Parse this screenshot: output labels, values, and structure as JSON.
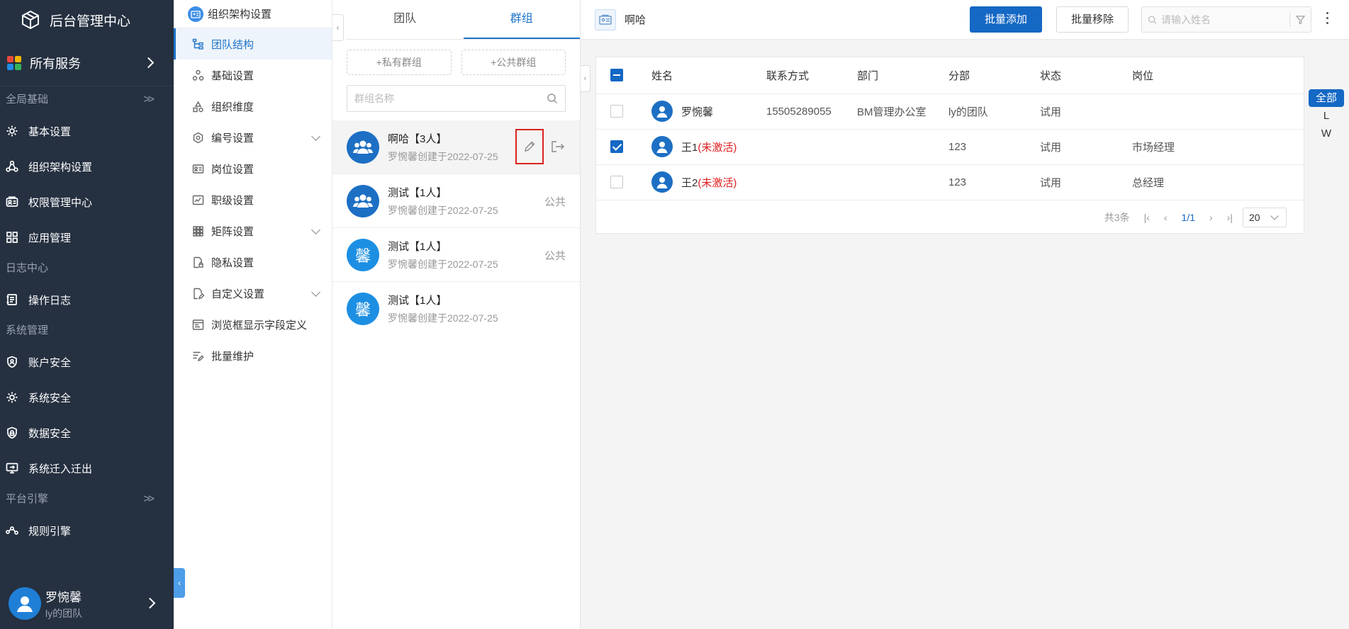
{
  "app": {
    "title": "后台管理中心"
  },
  "sidebar": {
    "all_services": "所有服务",
    "groups": [
      {
        "label": "全局基础",
        "items": [
          "基本设置",
          "组织架构设置",
          "权限管理中心",
          "应用管理"
        ]
      },
      {
        "label": "日志中心",
        "items": [
          "操作日志"
        ]
      },
      {
        "label": "系统管理",
        "items": [
          "账户安全",
          "系统安全",
          "数据安全",
          "系统迁入迁出"
        ]
      },
      {
        "label": "平台引擎",
        "items": [
          "规则引擎"
        ]
      }
    ],
    "user": {
      "name": "罗惋馨",
      "team": "ly的团队"
    }
  },
  "submenu": {
    "title": "组织架构设置",
    "items": [
      "团队结构",
      "基础设置",
      "组织维度",
      "编号设置",
      "岗位设置",
      "职级设置",
      "矩阵设置",
      "隐私设置",
      "自定义设置",
      "浏览框显示字段定义",
      "批量维护"
    ]
  },
  "group_panel": {
    "tabs": [
      "团队",
      "群组"
    ],
    "add_private": "+私有群组",
    "add_public": "+公共群组",
    "search_placeholder": "群组名称",
    "groups": [
      {
        "name": "啊哈【3人】",
        "sub": "罗惋馨创建于2022-07-25",
        "tag": "",
        "avatar": ""
      },
      {
        "name": "测试【1人】",
        "sub": "罗惋馨创建于2022-07-25",
        "tag": "公共",
        "avatar": ""
      },
      {
        "name": "测试【1人】",
        "sub": "罗惋馨创建于2022-07-25",
        "tag": "公共",
        "avatar": "馨"
      },
      {
        "name": "测试【1人】",
        "sub": "罗惋馨创建于2022-07-25",
        "tag": "",
        "avatar": "馨"
      }
    ]
  },
  "main": {
    "title": "啊哈",
    "batch_add": "批量添加",
    "batch_remove": "批量移除",
    "search_placeholder": "请输入姓名",
    "columns": [
      "姓名",
      "联系方式",
      "部门",
      "分部",
      "状态",
      "岗位"
    ],
    "rows": [
      {
        "name": "罗惋馨",
        "suffix": "",
        "phone": "15505289055",
        "dept": "BM管理办公室",
        "branch": "ly的团队",
        "status": "试用",
        "post": "",
        "checked": false
      },
      {
        "name": "王1",
        "suffix": "(未激活)",
        "phone": "",
        "dept": "",
        "branch": "123",
        "status": "试用",
        "post": "市场经理",
        "checked": true
      },
      {
        "name": "王2",
        "suffix": "(未激活)",
        "phone": "",
        "dept": "",
        "branch": "123",
        "status": "试用",
        "post": "总经理",
        "checked": false
      }
    ],
    "pagination": {
      "total": "共3条",
      "page": "1/1",
      "page_size": "20"
    },
    "letters": [
      "全部",
      "L",
      "W"
    ]
  },
  "colors": {
    "sidebar_bg": "#253040",
    "primary": "#1568c4",
    "inactive_red": "#e02020"
  }
}
